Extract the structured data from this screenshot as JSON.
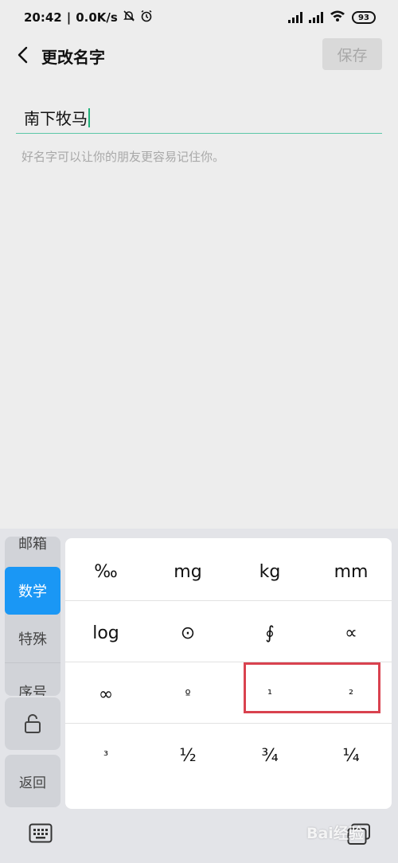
{
  "status_bar": {
    "time": "20:42",
    "speed": "0.0K/s",
    "battery": "93"
  },
  "header": {
    "title": "更改名字",
    "save_label": "保存"
  },
  "name_input": {
    "value": "南下牧马"
  },
  "hint": "好名字可以让你的朋友更容易记住你。",
  "keyboard": {
    "categories": [
      {
        "label": "邮箱"
      },
      {
        "label": "数学",
        "active": true
      },
      {
        "label": "特殊"
      },
      {
        "label": "序号"
      }
    ],
    "return_label": "返回",
    "symbols": [
      [
        "‰",
        "mg",
        "kg",
        "mm"
      ],
      [
        "log",
        "⊙",
        "∮",
        "∝"
      ],
      [
        "∞",
        "º",
        "¹",
        "²"
      ],
      [
        "³",
        "½",
        "¾",
        "¼"
      ]
    ]
  },
  "watermark": "Bai经验",
  "colors": {
    "accent_blue": "#1a97f5",
    "field_underline": "#5bc7a7",
    "highlight_red": "#d9424f"
  }
}
